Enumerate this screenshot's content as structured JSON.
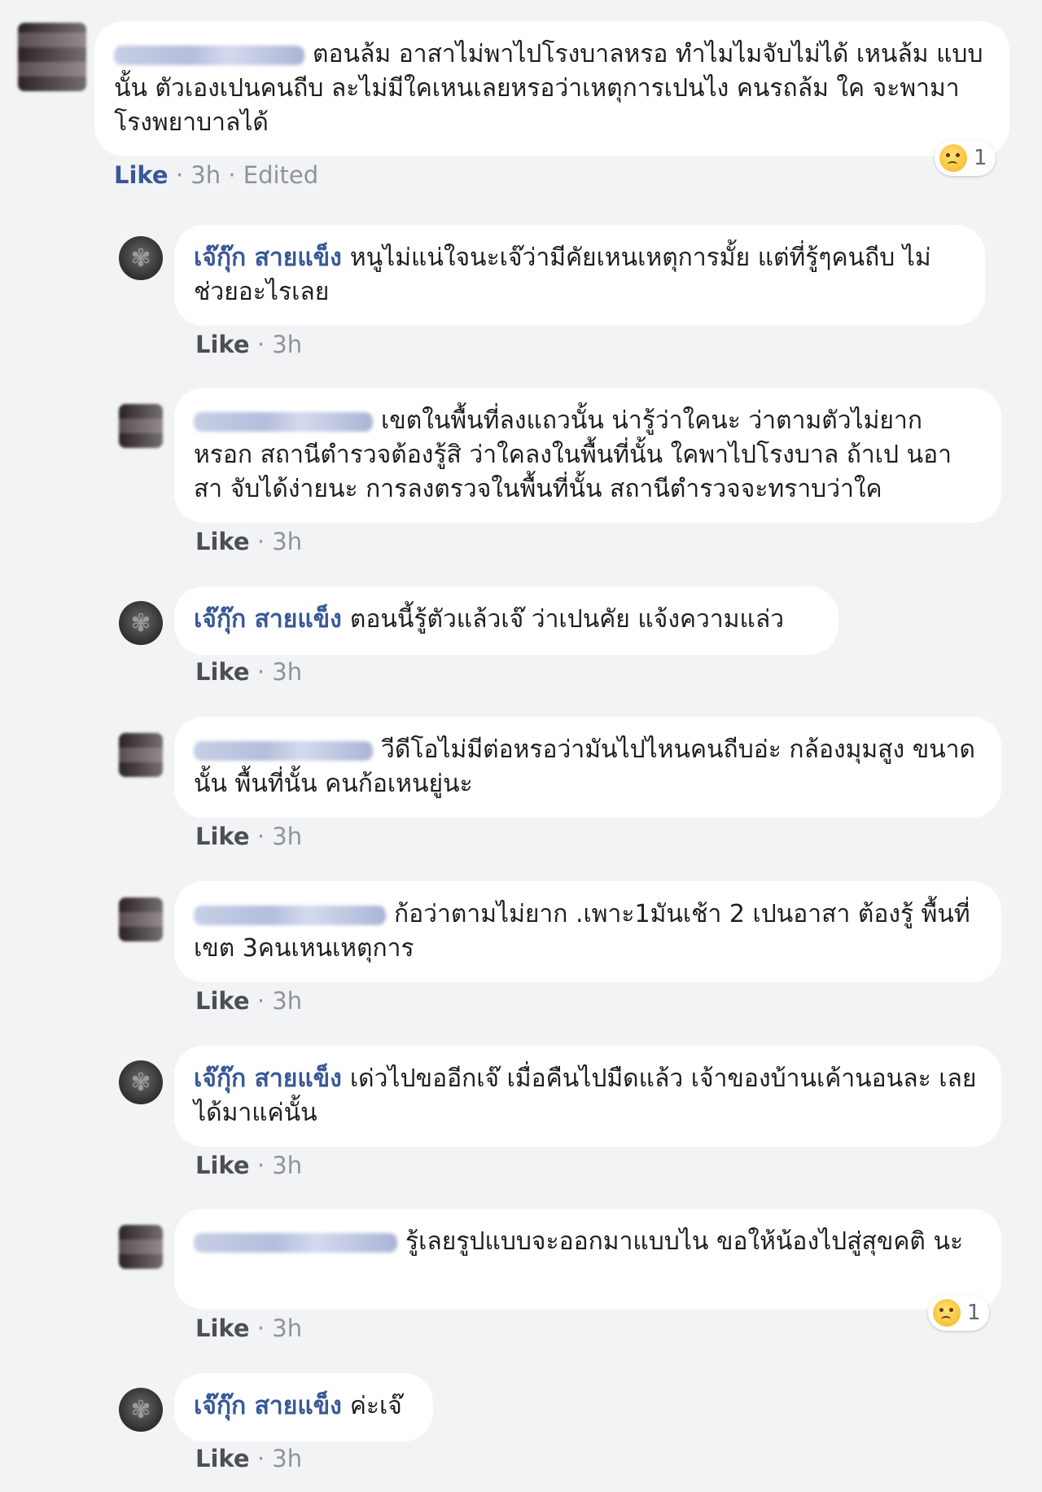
{
  "comments": [
    {
      "name": "",
      "text": "ตอนล้ม อาสาไม่พาไปโรงบาลหรอ ทำไมไมจับไม่ได้ เหนล้ม แบบนั้น ตัวเองเปนคนถีบ ละไม่มีใคเหนเลยหรอว่าเหตุการเปนไง คนรถล้ม ใค จะพามาโรงพยาบาลได้",
      "like": "Like",
      "time": "3h",
      "edited": "Edited",
      "reaction_count": "1"
    },
    {
      "name": "เจ๊กุ๊ก สายแข็ง",
      "text": "หนูไม่แน่ใจนะเจ๊ว่ามีคัยเหนเหตุการมั้ย แต่ที่รู้ๆคนถีบ ไม่ช่วยอะไรเลย",
      "like": "Like",
      "time": "3h"
    },
    {
      "name": "",
      "text": "เขตในพื้นที่ลงแถวนั้น น่ารู้ว่าใคนะ ว่าตามตัวไม่ยาก หรอก สถานีตำรวจต้องรู้สิ ว่าใคลงในพื้นที่นั้น ใคพาไปโรงบาล ถ้าเป นอาสา จับได้ง่ายนะ การลงตรวจในพื้นที่นั้น สถานีตำรวจจะทราบว่าใค",
      "like": "Like",
      "time": "3h"
    },
    {
      "name": "เจ๊กุ๊ก สายแข็ง",
      "text": "ตอนนี้รู้ตัวแล้วเจ๊ ว่าเปนคัย แจ้งความแล่ว",
      "like": "Like",
      "time": "3h"
    },
    {
      "name": "",
      "text": "วีดีโอไม่มีต่อหรอว่ามันไปไหนคนถีบอ่ะ กล้องมุมสูง ขนาดนั้น พื้นที่นั้น คนก้อเหนยู่นะ",
      "like": "Like",
      "time": "3h"
    },
    {
      "name": "",
      "text": "ก้อว่าตามไม่ยาก .เพาะ1มันเช้า 2 เปนอาสา ต้องรู้ พื้นที่เขต 3คนเหนเหตุการ",
      "like": "Like",
      "time": "3h"
    },
    {
      "name": "เจ๊กุ๊ก สายแข็ง",
      "text": "เด่วไปขออีกเจ๊ เมื่อคืนไปมืดแล้ว เจ้าของบ้านเค้านอนละ เลยได้มาแค่นั้น",
      "like": "Like",
      "time": "3h"
    },
    {
      "name": "",
      "text": "รู้เลยรูปแบบจะออกมาแบบไน ขอให้น้องไปสู่สุขคติ นะ",
      "like": "Like",
      "time": "3h",
      "reaction_count": "1"
    },
    {
      "name": "เจ๊กุ๊ก สายแข็ง",
      "text": "ค่ะเจ๊",
      "like": "Like",
      "time": "3h"
    }
  ],
  "separator": "·",
  "icons": {
    "reaction": "sad-face-icon",
    "avatar": "profile-avatar-icon"
  }
}
